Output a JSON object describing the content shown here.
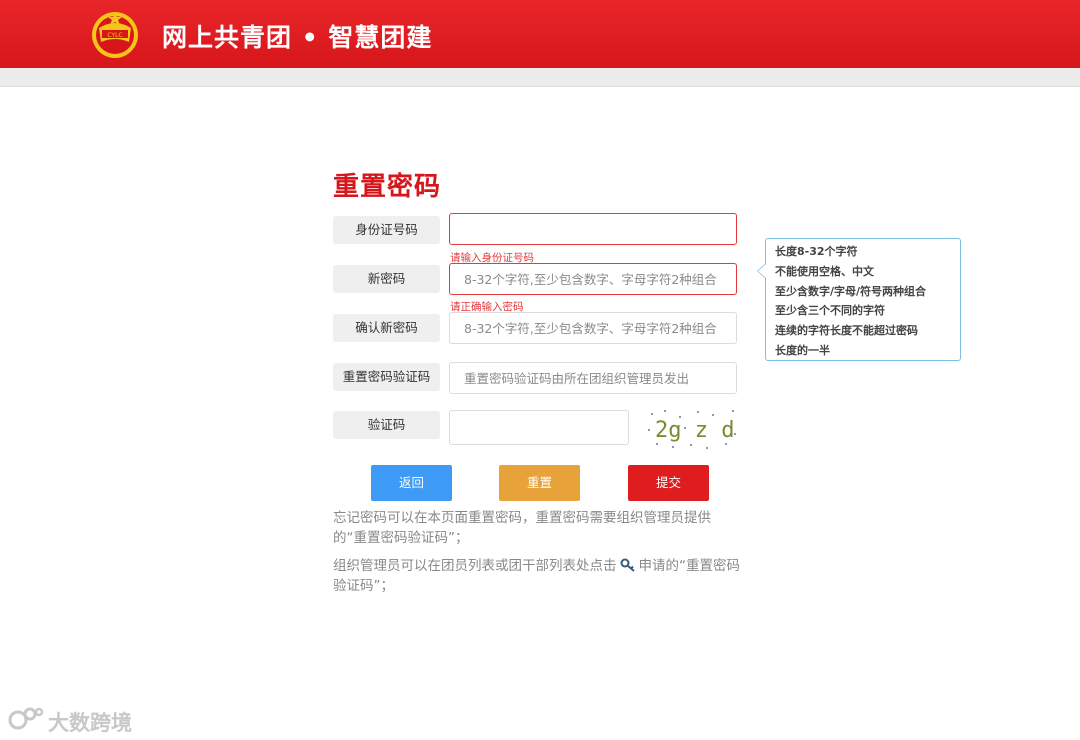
{
  "header": {
    "site_title": "网上共青团 • 智慧团建",
    "logo_text": "中国共青团"
  },
  "page": {
    "title": "重置密码"
  },
  "form": {
    "id_number": {
      "label": "身份证号码",
      "value": "",
      "placeholder": "",
      "error": "请输入身份证号码"
    },
    "new_password": {
      "label": "新密码",
      "value": "",
      "placeholder": "8-32个字符,至少包含数字、字母字符2种组合",
      "error": "请正确输入密码"
    },
    "confirm_password": {
      "label": "确认新密码",
      "value": "",
      "placeholder": "8-32个字符,至少包含数字、字母字符2种组合"
    },
    "reset_code": {
      "label": "重置密码验证码",
      "value": "",
      "placeholder": "重置密码验证码由所在团组织管理员发出"
    },
    "captcha": {
      "label": "验证码",
      "value": "",
      "placeholder": "",
      "image_text": "2g z d ."
    }
  },
  "password_tip": {
    "lines": [
      "长度8-32个字符",
      "不能使用空格、中文",
      "至少含数字/字母/符号两种组合",
      "至少含三个不同的字符",
      "连续的字符长度不能超过密码",
      "长度的一半"
    ]
  },
  "buttons": {
    "back": "返回",
    "reset": "重置",
    "submit": "提交"
  },
  "notes": {
    "note1": "忘记密码可以在本页面重置密码，重置密码需要组织管理员提供的“重置密码验证码”；",
    "note2_before": "组织管理员可以在团员列表或团干部列表处点击",
    "note2_after": "申请的“重置密码验证码”；"
  },
  "watermark": {
    "text": "大数跨境"
  },
  "colors": {
    "header_red": "#d7161b",
    "title_red": "#d7161b",
    "error_red": "#e4393c",
    "back_blue": "#3d9bf6",
    "reset_orange": "#e8a23a",
    "submit_red": "#df1d1f",
    "tip_border": "#7fbfe6"
  },
  "icons": {
    "logo": "youth-league-emblem",
    "key": "key-icon"
  }
}
